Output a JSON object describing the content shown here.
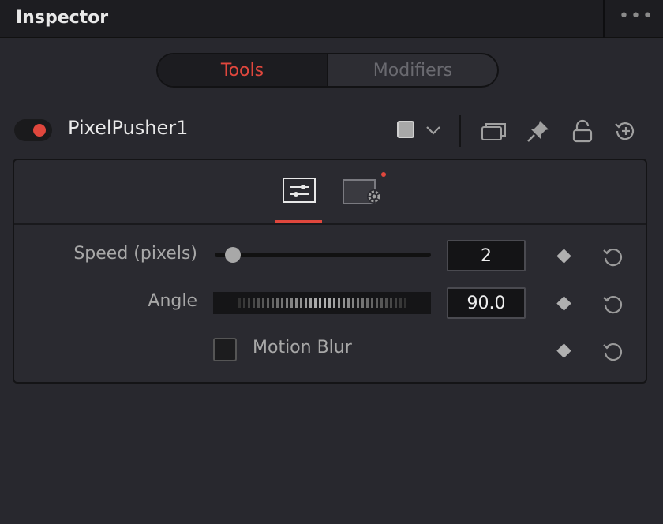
{
  "header": {
    "title": "Inspector",
    "more_label": "•••"
  },
  "tabs": [
    {
      "label": "Tools",
      "active": true
    },
    {
      "label": "Modifiers",
      "active": false
    }
  ],
  "tool": {
    "name": "PixelPusher1",
    "enabled": true,
    "accent_color": "#e0473d",
    "color_swatch": "#a8a8a8",
    "icons": [
      "color-dropdown-chevron-icon",
      "versions-icon",
      "pin-icon",
      "lock-icon",
      "reset-tool-icon"
    ]
  },
  "panel_tabs": [
    {
      "icon": "sliders-icon",
      "active": true
    },
    {
      "icon": "settings-icon",
      "active": false,
      "modified": true
    }
  ],
  "controls": {
    "speed": {
      "label": "Speed (pixels)",
      "value": "2",
      "slider_fraction": 0.07
    },
    "angle": {
      "label": "Angle",
      "value": "90.0"
    },
    "motion_blur": {
      "label": "Motion Blur",
      "checked": false
    }
  }
}
